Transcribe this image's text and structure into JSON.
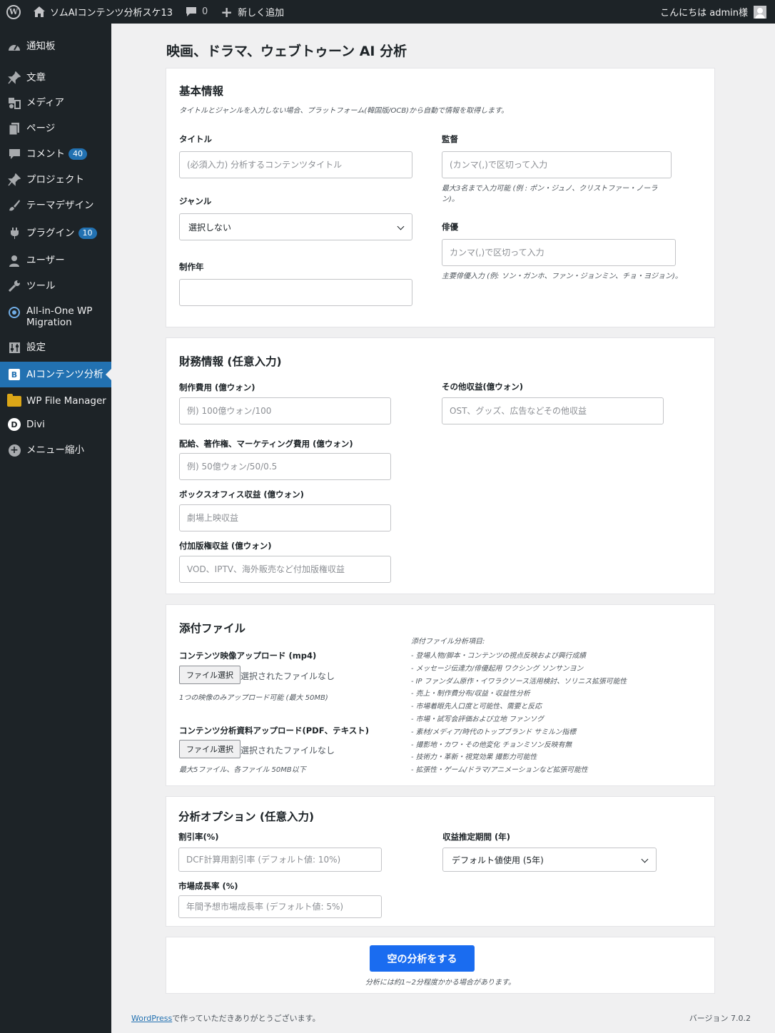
{
  "adminbar": {
    "site_name": "ソムAIコンテンツ分析スケ13",
    "comments_count": "0",
    "new_label": "新しく追加",
    "greeting": "こんにちは admin様"
  },
  "sidebar": {
    "items": [
      {
        "label": "通知板",
        "icon": "dashboard-icon"
      },
      {
        "label": "文章",
        "icon": "pin-icon"
      },
      {
        "label": "メディア",
        "icon": "media-icon"
      },
      {
        "label": "ページ",
        "icon": "page-icon"
      },
      {
        "label": "コメント",
        "icon": "comment-icon",
        "badge": "40"
      },
      {
        "label": "プロジェクト",
        "icon": "pin-icon"
      },
      {
        "label": "テーマデザイン",
        "icon": "brush-icon"
      },
      {
        "label": "プラグイン",
        "icon": "plugin-icon",
        "badge": "10"
      },
      {
        "label": "ユーザー",
        "icon": "user-icon"
      },
      {
        "label": "ツール",
        "icon": "wrench-icon"
      },
      {
        "label": "All-in-One WP Migration",
        "icon": "migration-icon"
      },
      {
        "label": "設定",
        "icon": "settings-icon"
      },
      {
        "label": "AIコンテンツ分析",
        "icon": "b-icon"
      },
      {
        "label": "WP File Manager",
        "icon": "folder-icon"
      },
      {
        "label": "Divi",
        "icon": "divi-icon"
      },
      {
        "label": "メニュー縮小",
        "icon": "collapse-icon"
      }
    ]
  },
  "page": {
    "title": "映画、ドラマ、ウェブトゥーン AI 分析"
  },
  "basic": {
    "title": "基本情報",
    "desc": "タイトルとジャンルを入力しない場合、プラットフォーム(韓国版/OCB)から自動で情報を取得します。",
    "title_label": "タイトル",
    "title_placeholder": "(必須入力) 分析するコンテンツタイトル",
    "genre_label": "ジャンル",
    "genre_value": "選択しない",
    "year_label": "制作年",
    "director_label": "監督",
    "director_placeholder": "(カンマ(,)で区切って入力",
    "director_help": "最大3名まで入力可能 (例 : ポン・ジュノ、クリストファー・ノーラン)。",
    "actor_label": "俳優",
    "actor_placeholder": "カンマ(,)で区切って入力",
    "actor_help": "主要俳優入力 (例: ソン・ガンホ、ファン・ジョンミン、チョ・ヨジョン)。"
  },
  "finance": {
    "title": "財務情報 (任意入力)",
    "cost_label": "制作費用 (億ウォン)",
    "cost_placeholder": "例) 100億ウォン/100",
    "dist_label": "配給、著作権、マーケティング費用 (億ウォン)",
    "dist_placeholder": "例) 50億ウォン/50/0.5",
    "box_label": "ボックスオフィス収益 (億ウォン)",
    "box_placeholder": "劇場上映収益",
    "extra_label": "付加版権収益 (億ウォン)",
    "extra_placeholder": "VOD、IPTV、海外販売など付加版権収益",
    "other_label": "その他収益(億ウォン)",
    "other_placeholder": "OST、グッズ、広告などその他収益"
  },
  "files": {
    "title": "添付ファイル",
    "video_label": "コンテンツ映像アップロード (mp4)",
    "file_button": "ファイル選択",
    "no_file": "選択されたファイルなし",
    "video_help": "1つの映像のみアップロード可能 (最大 50MB)",
    "doc_label": "コンテンツ分析資料アップロード(PDF、テキスト)",
    "doc_help": "最大5ファイル、各ファイル 50MB以下",
    "analysis_title": "添付ファイル分析項目:",
    "analysis_items": [
      "- 登場人物/脚本・コンテンツの視点反映および興行成績",
      "- メッセージ伝達力/俳優起用 ワクシング ソンサンヨン",
      "- IP ファンダム原作・イワラクソース活用検討、ソリニス拡張可能性",
      "- 売上・制作費分布/収益・収益性分析",
      "- 市場着眼先人口度と可能性、需要と反応",
      "- 市場・試写会評価および立地 ファンソグ",
      "- 素材/メディア/時代のトップブランド サミルン指標",
      "- 撮影地・カワ・その他変化 チョンミソン反映有無",
      "- 技術力・革新・視覚効果 撮影力可能性",
      "- 拡張性・ゲーム/ドラマ/アニメーションなど拡張可能性"
    ]
  },
  "options": {
    "title": "分析オプション (任意入力)",
    "discount_label": "割引率(%)",
    "discount_placeholder": "DCF計算用割引率 (デフォルト値: 10%)",
    "growth_label": "市場成長率 (%)",
    "growth_placeholder": "年間予想市場成長率 (デフォルト値: 5%)",
    "period_label": "収益推定期間 (年)",
    "period_value": "デフォルト値使用 (5年)"
  },
  "submit": {
    "label": "空の分析をする",
    "note": "分析には約1~2分程度かかる場合があります。"
  },
  "footer": {
    "link": "WordPress",
    "text": "で作っていただきありがとうございます。",
    "version": "バージョン 7.0.2"
  }
}
